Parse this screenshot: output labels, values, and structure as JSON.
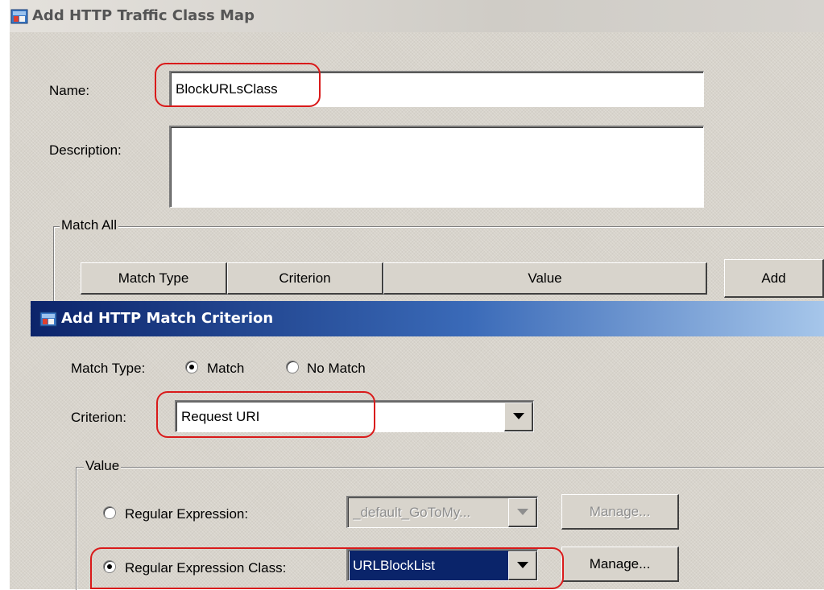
{
  "outer_dialog": {
    "title": "Add HTTP Traffic Class Map",
    "name_label": "Name:",
    "name_value": "BlockURLsClass",
    "description_label": "Description:",
    "description_value": "",
    "match_group_label": "Match All",
    "table_headers": [
      "Match Type",
      "Criterion",
      "Value"
    ],
    "add_button": "Add"
  },
  "inner_dialog": {
    "title": "Add HTTP Match Criterion",
    "match_type_label": "Match Type:",
    "match_option": "Match",
    "no_match_option": "No Match",
    "selected_match_type": "Match",
    "criterion_label": "Criterion:",
    "criterion_value": "Request URI",
    "value_group_label": "Value",
    "regex_label": "Regular Expression:",
    "regex_value": "_default_GoToMy...",
    "regex_manage_button": "Manage...",
    "regex_class_label": "Regular Expression Class:",
    "regex_class_value": "URLBlockList",
    "regex_class_manage_button": "Manage...",
    "selected_value_option": "Regular Expression Class"
  },
  "colors": {
    "highlight": "#d91a1a",
    "title_active": "#0c246a",
    "selection": "#0a246a"
  }
}
